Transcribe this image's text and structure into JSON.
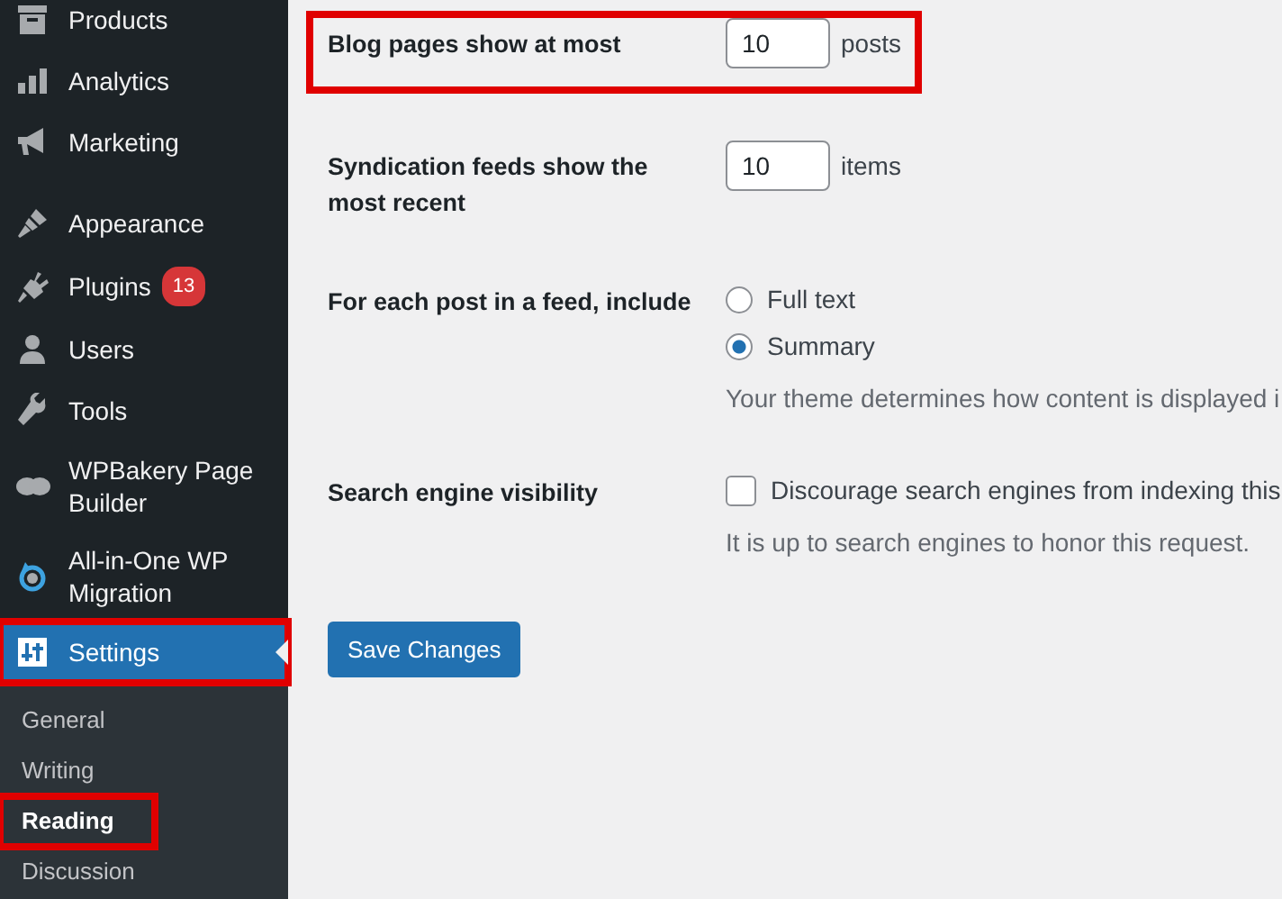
{
  "sidebar": {
    "groups": [
      [
        {
          "label": "Products",
          "selected": false,
          "highlighted": false
        },
        {
          "label": "Analytics",
          "selected": false,
          "highlighted": false
        },
        {
          "label": "Marketing",
          "selected": false,
          "highlighted": false
        }
      ],
      [
        {
          "label": "Appearance",
          "selected": false,
          "highlighted": false
        },
        {
          "label": "Plugins",
          "badge": "13",
          "selected": false,
          "highlighted": false
        },
        {
          "label": "Users",
          "selected": false,
          "highlighted": false
        },
        {
          "label": "Tools",
          "selected": false,
          "highlighted": false
        },
        {
          "label": "WPBakery Page Builder",
          "selected": false,
          "highlighted": false
        },
        {
          "label": "All-in-One WP Migration",
          "selected": false,
          "highlighted": false
        },
        {
          "label": "Settings",
          "selected": true,
          "highlighted": true
        }
      ]
    ],
    "submenu": [
      {
        "label": "General",
        "selected": false,
        "highlighted": false
      },
      {
        "label": "Writing",
        "selected": false,
        "highlighted": false
      },
      {
        "label": "Reading",
        "selected": true,
        "highlighted": true
      },
      {
        "label": "Discussion",
        "selected": false,
        "highlighted": false
      }
    ]
  },
  "settings": [
    {
      "kind": "number",
      "label": "Blog pages show at most",
      "value": "10",
      "unit": "posts",
      "highlighted": true
    },
    {
      "kind": "number",
      "label": "Syndication feeds show the most recent",
      "value": "10",
      "unit": "items",
      "highlighted": false
    },
    {
      "kind": "radio",
      "label": "For each post in a feed, include",
      "options": [
        {
          "label": "Full text",
          "selected": false
        },
        {
          "label": "Summary",
          "selected": true
        }
      ],
      "description": "Your theme determines how content is displayed i"
    },
    {
      "kind": "checkbox",
      "label": "Search engine visibility",
      "option": "Discourage search engines from indexing this",
      "checked": false,
      "description": "It is up to search engines to honor this request."
    }
  ],
  "save_button": "Save Changes"
}
